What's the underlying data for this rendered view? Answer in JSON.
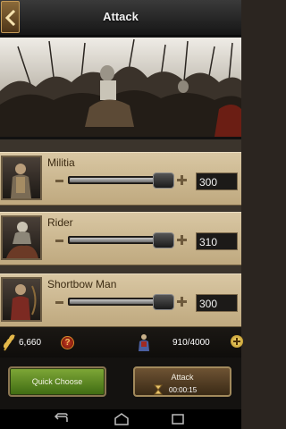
{
  "header": {
    "title": "Attack",
    "back_icon": "chevron-left-icon"
  },
  "banner": {
    "icon": "battle-scene-illustration"
  },
  "troops": [
    {
      "name": "Militia",
      "quantity": "300",
      "slider_fraction": 0.9
    },
    {
      "name": "Rider",
      "quantity": "310",
      "slider_fraction": 0.9
    },
    {
      "name": "Shortbow Man",
      "quantity": "300",
      "slider_fraction": 0.9
    }
  ],
  "resources": {
    "food_icon": "wheat-icon",
    "food_amount": "6,660",
    "help_icon": "question-icon",
    "help_label": "?",
    "troops_icon": "soldier-icon",
    "troop_capacity": "910/4000",
    "add_icon": "plus-icon"
  },
  "actions": {
    "quick_choose_label": "Quick Choose",
    "attack_label": "Attack",
    "attack_time": "00:00:15",
    "timer_icon": "hourglass-icon"
  },
  "colors": {
    "panel": "#d9c7a3",
    "quick_choose_green": "#5f8a22",
    "attack_brown": "#5a4226",
    "header": "#242424"
  }
}
